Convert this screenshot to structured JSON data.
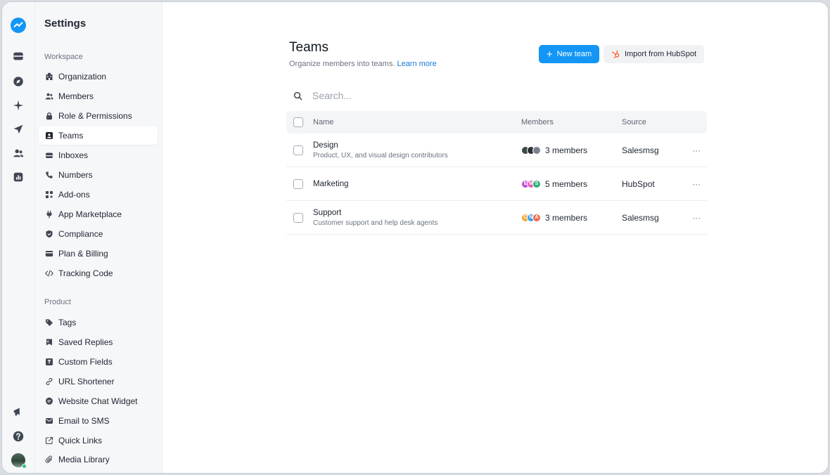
{
  "rail": {
    "items": [
      {
        "name": "logo-icon"
      },
      {
        "name": "inbox-icon"
      },
      {
        "name": "compass-icon"
      },
      {
        "name": "sparkle-icon"
      },
      {
        "name": "send-icon"
      },
      {
        "name": "contacts-icon"
      },
      {
        "name": "reports-icon"
      }
    ],
    "bottom": [
      {
        "name": "megaphone-icon"
      },
      {
        "name": "help-icon"
      },
      {
        "name": "user-avatar"
      }
    ]
  },
  "sidebar": {
    "title": "Settings",
    "workspace_label": "Workspace",
    "product_label": "Product",
    "workspace_items": [
      {
        "label": "Organization",
        "icon": "building-icon"
      },
      {
        "label": "Members",
        "icon": "members-icon"
      },
      {
        "label": "Role & Permissions",
        "icon": "lock-icon"
      },
      {
        "label": "Teams",
        "icon": "team-card-icon",
        "active": true
      },
      {
        "label": "Inboxes",
        "icon": "inbox-icon"
      },
      {
        "label": "Numbers",
        "icon": "phone-icon"
      },
      {
        "label": "Add-ons",
        "icon": "add-ons-icon"
      },
      {
        "label": "App Marketplace",
        "icon": "plug-icon"
      },
      {
        "label": "Compliance",
        "icon": "shield-icon"
      },
      {
        "label": "Plan & Billing",
        "icon": "credit-card-icon"
      },
      {
        "label": "Tracking Code",
        "icon": "code-icon"
      }
    ],
    "product_items": [
      {
        "label": "Tags",
        "icon": "tag-icon"
      },
      {
        "label": "Saved Replies",
        "icon": "saved-replies-icon"
      },
      {
        "label": "Custom Fields",
        "icon": "custom-fields-icon"
      },
      {
        "label": "URL Shortener",
        "icon": "link-icon"
      },
      {
        "label": "Website Chat Widget",
        "icon": "chat-icon"
      },
      {
        "label": "Email to SMS",
        "icon": "mail-icon"
      },
      {
        "label": "Quick Links",
        "icon": "external-link-icon"
      },
      {
        "label": "Media Library",
        "icon": "paperclip-icon"
      }
    ]
  },
  "header": {
    "title": "Teams",
    "subtitle": "Organize members into teams.",
    "learn_more": "Learn more",
    "new_team_label": "New team",
    "import_label": "Import from HubSpot"
  },
  "search": {
    "placeholder": "Search..."
  },
  "table": {
    "columns": {
      "name": "Name",
      "members": "Members",
      "source": "Source"
    },
    "rows": [
      {
        "name": "Design",
        "description": "Product, UX, and visual design contributors",
        "members": "3 members",
        "source": "Salesmsg",
        "avatars": [
          {
            "color": "#3a4a3f",
            "letter": ""
          },
          {
            "color": "#2b2f36",
            "letter": ""
          },
          {
            "color": "#7a828c",
            "letter": ""
          }
        ]
      },
      {
        "name": "Marketing",
        "description": "",
        "members": "5 members",
        "source": "HubSpot",
        "avatars": [
          {
            "color": "#c04ad8",
            "letter": "E"
          },
          {
            "color": "#e45fb6",
            "letter": "M"
          },
          {
            "color": "#2faf78",
            "letter": "S"
          }
        ]
      },
      {
        "name": "Support",
        "description": "Customer support and help desk agents",
        "members": "3 members",
        "source": "Salesmsg",
        "avatars": [
          {
            "color": "#f3a83a",
            "letter": "C"
          },
          {
            "color": "#3ba0e8",
            "letter": "N"
          },
          {
            "color": "#ef6a4c",
            "letter": "A"
          }
        ]
      }
    ]
  },
  "colors": {
    "accent": "#1496f6",
    "hubspot": "#ff5c35",
    "active_bg": "#ffffff"
  }
}
